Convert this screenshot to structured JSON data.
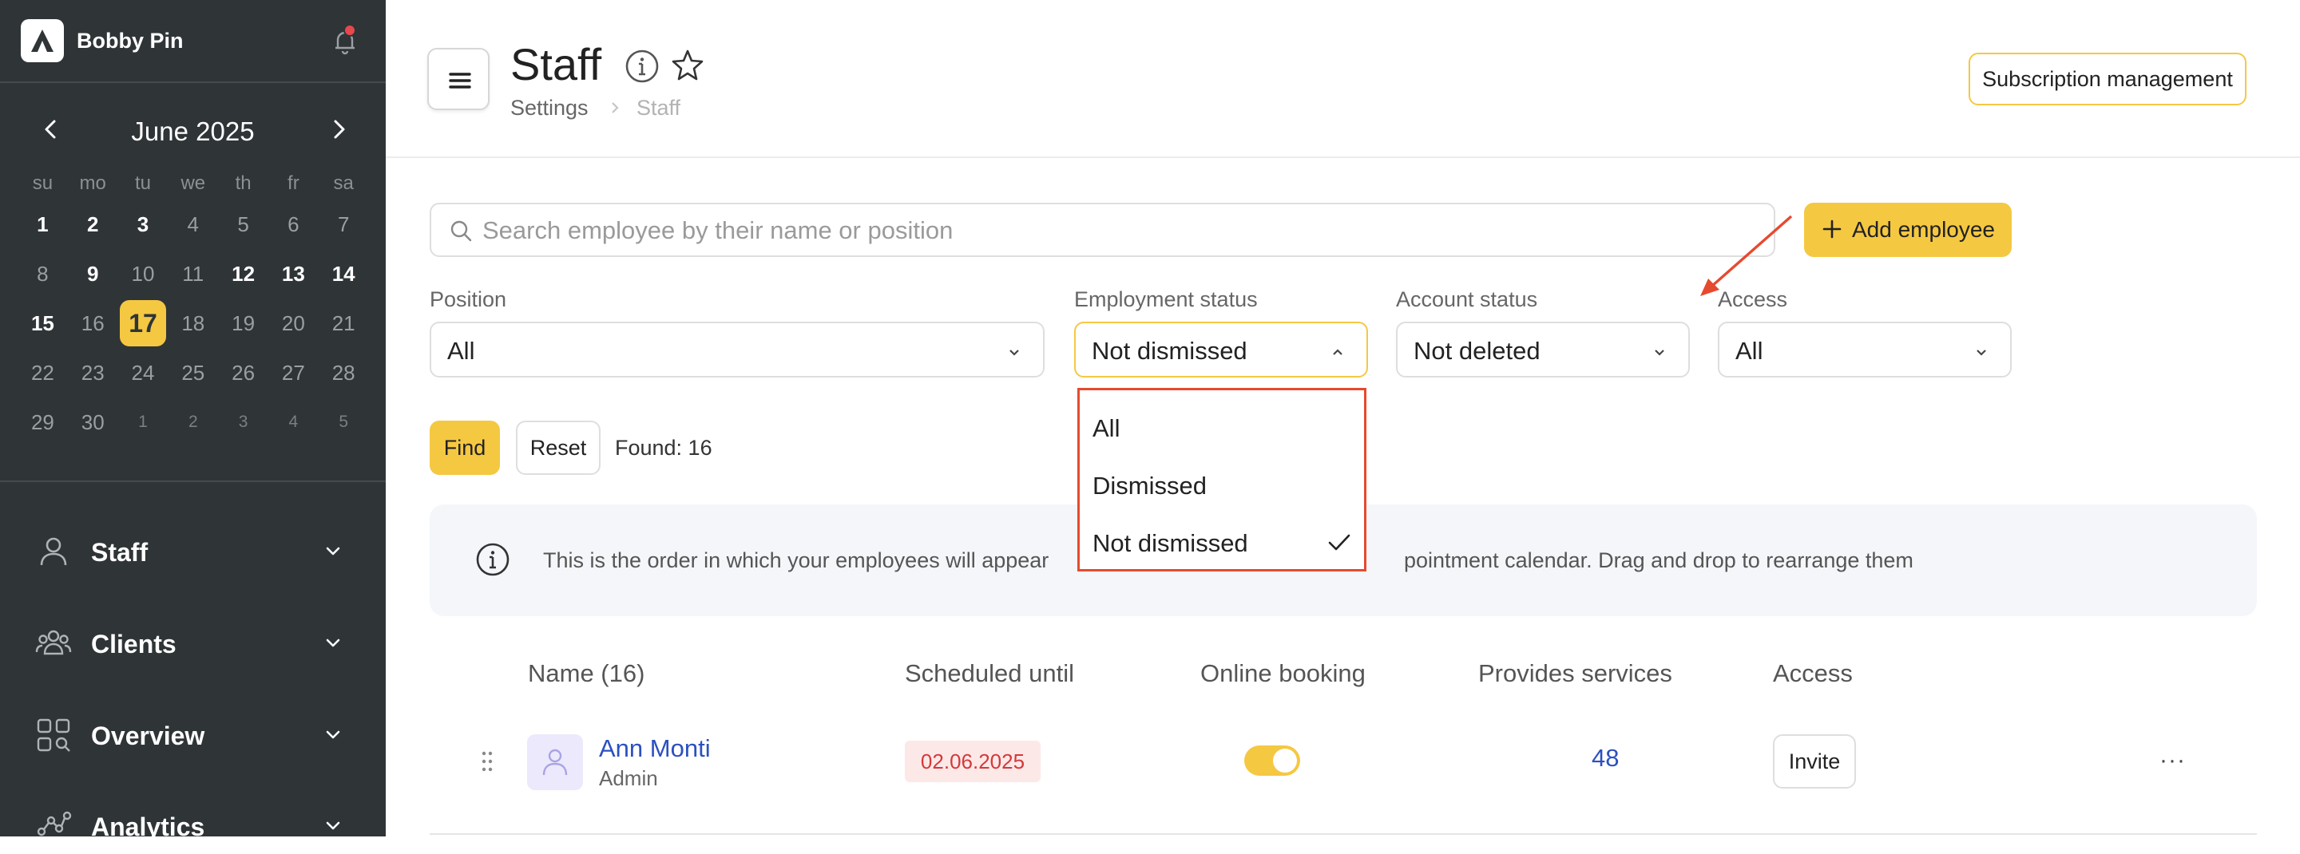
{
  "sidebar": {
    "user_name": "Bobby Pin",
    "calendar": {
      "title": "June 2025",
      "weekdays": [
        "su",
        "mo",
        "tu",
        "we",
        "th",
        "fr",
        "sa"
      ],
      "weeks": [
        [
          "1",
          "2",
          "3",
          "4",
          "5",
          "6",
          "7"
        ],
        [
          "8",
          "9",
          "10",
          "11",
          "12",
          "13",
          "14"
        ],
        [
          "15",
          "16",
          "17",
          "18",
          "19",
          "20",
          "21"
        ],
        [
          "22",
          "23",
          "24",
          "25",
          "26",
          "27",
          "28"
        ],
        [
          "29",
          "30",
          "1",
          "2",
          "3",
          "4",
          "5"
        ]
      ],
      "today": "17"
    },
    "nav": [
      {
        "label": "Staff",
        "icon": "person-icon"
      },
      {
        "label": "Clients",
        "icon": "people-icon"
      },
      {
        "label": "Overview",
        "icon": "grid-search-icon"
      },
      {
        "label": "Analytics",
        "icon": "analytics-icon"
      }
    ]
  },
  "header": {
    "title": "Staff",
    "breadcrumb": [
      "Settings",
      "Staff"
    ],
    "subscription_label": "Subscription management"
  },
  "search": {
    "placeholder": "Search employee by their name or position",
    "add_label": "Add employee"
  },
  "filters": {
    "position": {
      "label": "Position",
      "value": "All"
    },
    "employment": {
      "label": "Employment status",
      "value": "Not dismissed"
    },
    "account": {
      "label": "Account status",
      "value": "Not deleted"
    },
    "access": {
      "label": "Access",
      "value": "All"
    }
  },
  "dropdown": {
    "options": [
      "All",
      "Dismissed",
      "Not dismissed"
    ],
    "selected": "Not dismissed"
  },
  "actions": {
    "find": "Find",
    "reset": "Reset",
    "found": "Found: 16"
  },
  "info": {
    "text_left": "This is the order in which your employees will appear",
    "text_right": "pointment calendar. Drag and drop to rearrange them"
  },
  "table": {
    "headers": [
      "Name (16)",
      "Scheduled until",
      "Online booking",
      "Provides services",
      "Access"
    ],
    "rows": [
      {
        "name": "Ann Monti",
        "role": "Admin",
        "scheduled": "02.06.2025",
        "online": true,
        "services": "48",
        "access": "Invite"
      }
    ]
  },
  "colors": {
    "accent": "#f5c842",
    "sidebar_bg": "#2f3437",
    "highlight": "#e64a2e",
    "link": "#2b50c0"
  }
}
